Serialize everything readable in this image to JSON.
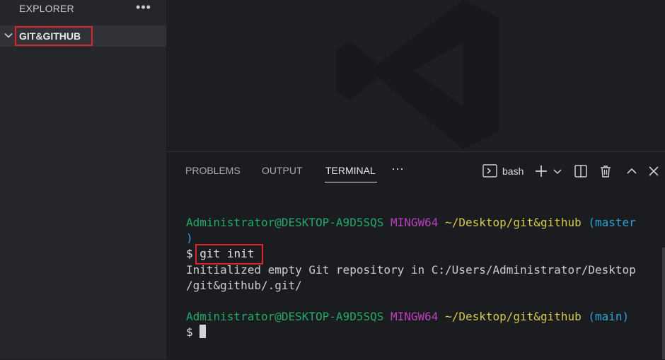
{
  "sidebar": {
    "title": "EXPLORER",
    "more_icon": "ellipsis-icon",
    "folder": {
      "label": "GIT&GITHUB",
      "icon": "chevron-down-icon"
    }
  },
  "editor": {
    "watermark": "vscode-logo-icon"
  },
  "panel": {
    "tabs": [
      {
        "label": "PROBLEMS"
      },
      {
        "label": "OUTPUT"
      },
      {
        "label": "TERMINAL",
        "active": true
      }
    ],
    "tabs_more": "⋯",
    "shell": "bash",
    "actions": [
      "terminal-icon",
      "plus-icon",
      "chevron-down-icon",
      "split-icon",
      "trash-icon",
      "chevron-up-icon",
      "close-icon"
    ]
  },
  "terminal": {
    "prompt1": {
      "user": "Administrator@DESKTOP-A9D5SQS",
      "system": "MINGW64",
      "path": "~/Desktop/git&github",
      "branch_open": "(master",
      "branch_close": ")"
    },
    "command": {
      "dollar": "$",
      "text": "git init"
    },
    "output_line1": "Initialized empty Git repository in C:/Users/Administrator/Desktop",
    "output_line2": "/git&github/.git/",
    "prompt2": {
      "user": "Administrator@DESKTOP-A9D5SQS",
      "system": "MINGW64",
      "path": "~/Desktop/git&github",
      "branch": "(main)"
    },
    "dollar2": "$"
  },
  "colors": {
    "highlight": "#e0242b",
    "user": "#23a86b",
    "system": "#bc3fbc",
    "path": "#d7c94a",
    "branch": "#2aa4d4"
  }
}
